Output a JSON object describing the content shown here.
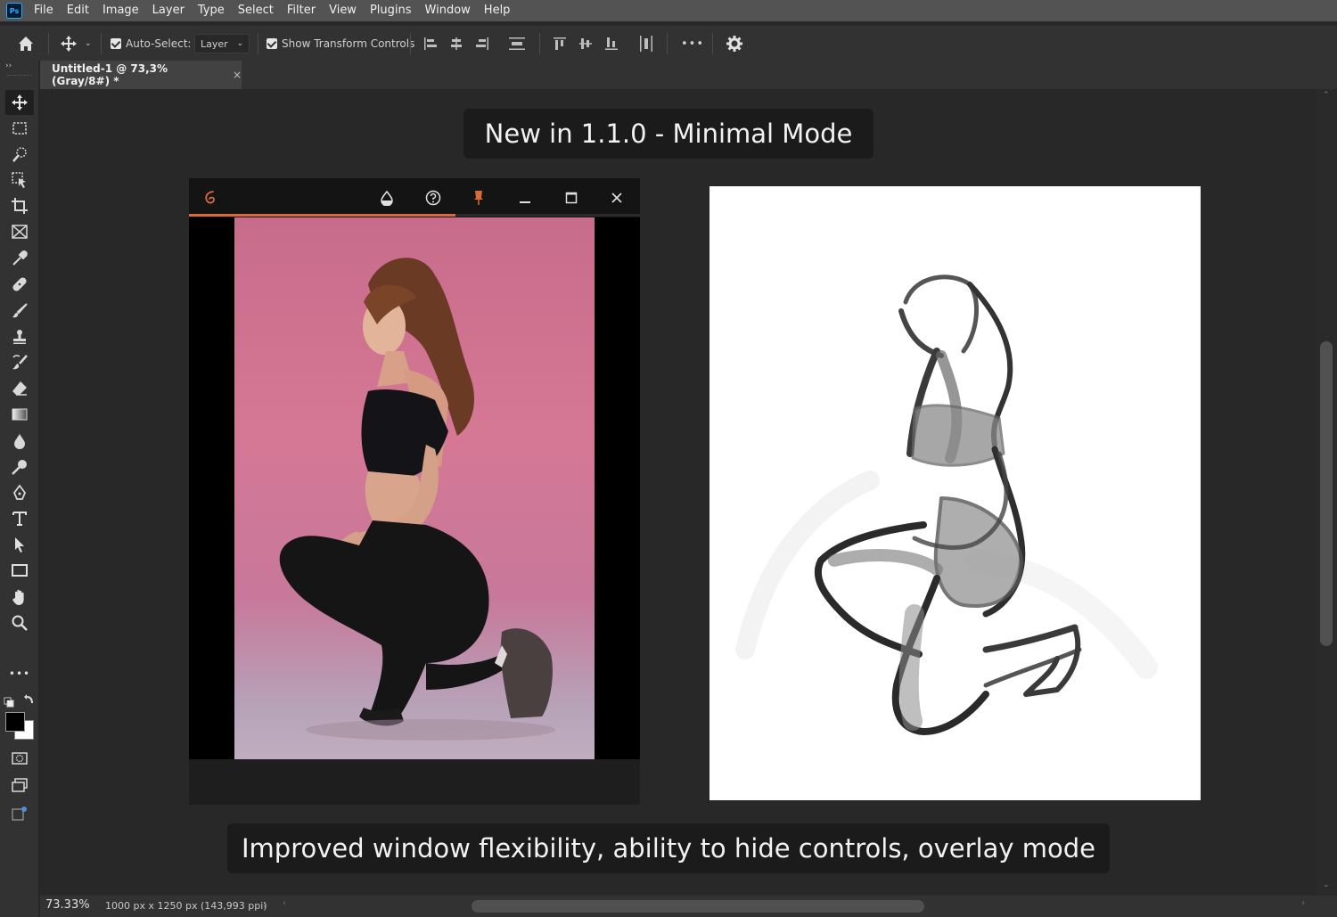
{
  "app": {
    "logo": "Ps",
    "menu": [
      "File",
      "Edit",
      "Image",
      "Layer",
      "Type",
      "Select",
      "Filter",
      "View",
      "Plugins",
      "Window",
      "Help"
    ]
  },
  "options_bar": {
    "auto_select_label": "Auto-Select:",
    "auto_select_checked": true,
    "auto_select_target": "Layer",
    "show_transform_label": "Show Transform Controls",
    "show_transform_checked": true,
    "more_label": "•••"
  },
  "document": {
    "tab_title": "Untitled-1 @ 73,3% (Gray/8#) *",
    "close_label": "×"
  },
  "canvas": {
    "caption_top": "New in 1.1.0 - Minimal Mode",
    "caption_bottom": "Improved window flexibility, ability to hide controls, overlay mode"
  },
  "plugin_window": {
    "accent_color": "#d86a3c",
    "progress_fraction": 0.59,
    "controls": [
      "logo-icon",
      "droplet-icon",
      "help-icon",
      "pin-icon",
      "minimize-icon",
      "maximize-icon",
      "close-icon"
    ]
  },
  "status_bar": {
    "zoom": "73.33%",
    "doc_info": "1000 px x 1250 px (143,993 ppi)",
    "arrow": "›"
  },
  "toolbar": {
    "expand_label": "››",
    "more_label": "•••"
  }
}
